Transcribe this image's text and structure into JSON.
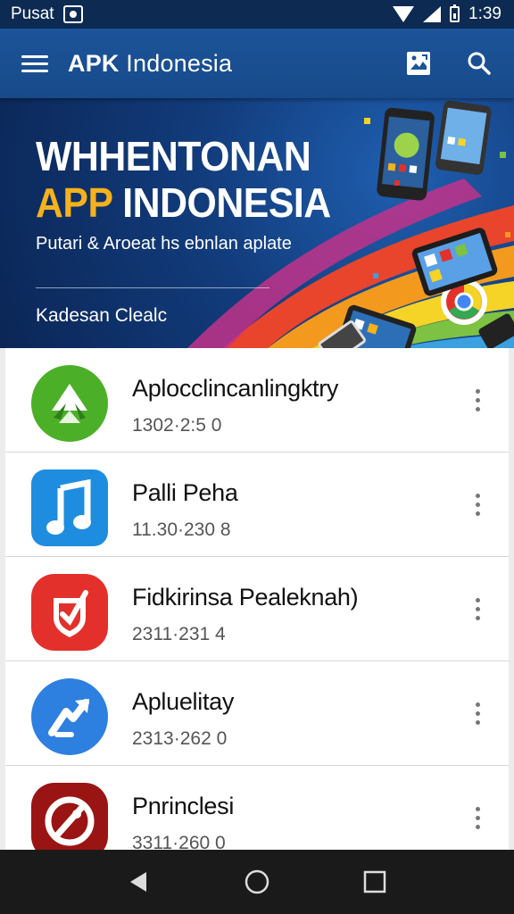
{
  "status_bar": {
    "carrier": "Pusat",
    "time": "1:39",
    "icons": [
      "notification-icon",
      "wifi-icon",
      "signal-icon",
      "battery-icon"
    ]
  },
  "app_bar": {
    "title_bold": "APK",
    "title_rest": " Indonesia",
    "icons": [
      "menu-icon",
      "image-icon",
      "search-icon"
    ]
  },
  "banner": {
    "line1": "WHHENTONAN",
    "line2_accent": "APP",
    "line2_rest": " INDONESIA",
    "subtitle": "Putari & Aroeat hs ebnlan aplate",
    "link": "Kadesan Clealc"
  },
  "apps": [
    {
      "name": "Aplocclincanlingktry",
      "meta": "1302·2:5 0",
      "icon": "green-arrows-icon",
      "color": "#4caf28"
    },
    {
      "name": "Palli Peha",
      "meta": "11.30·230 8",
      "icon": "music-note-icon",
      "color": "#1e8de0"
    },
    {
      "name": "Fidkirinsa Pealeknah)",
      "meta": "2311·231 4",
      "icon": "shield-check-icon",
      "color": "#e4302a"
    },
    {
      "name": "Apluelitay",
      "meta": "2313·262 0",
      "icon": "arrow-circle-icon",
      "color": "#2d7fe0"
    },
    {
      "name": "Pnrinclesi",
      "meta": "3311·260 0",
      "icon": "no-entry-icon",
      "color": "#9b1414"
    }
  ],
  "nav_bar": {
    "icons": [
      "back-icon",
      "home-icon",
      "recents-icon"
    ]
  },
  "colors": {
    "status_bar": "#0d2a52",
    "app_bar": "#1c5499",
    "banner_accent": "#f5b21c",
    "list_background": "#ffffff",
    "nav_bar": "#1a1a1a"
  }
}
